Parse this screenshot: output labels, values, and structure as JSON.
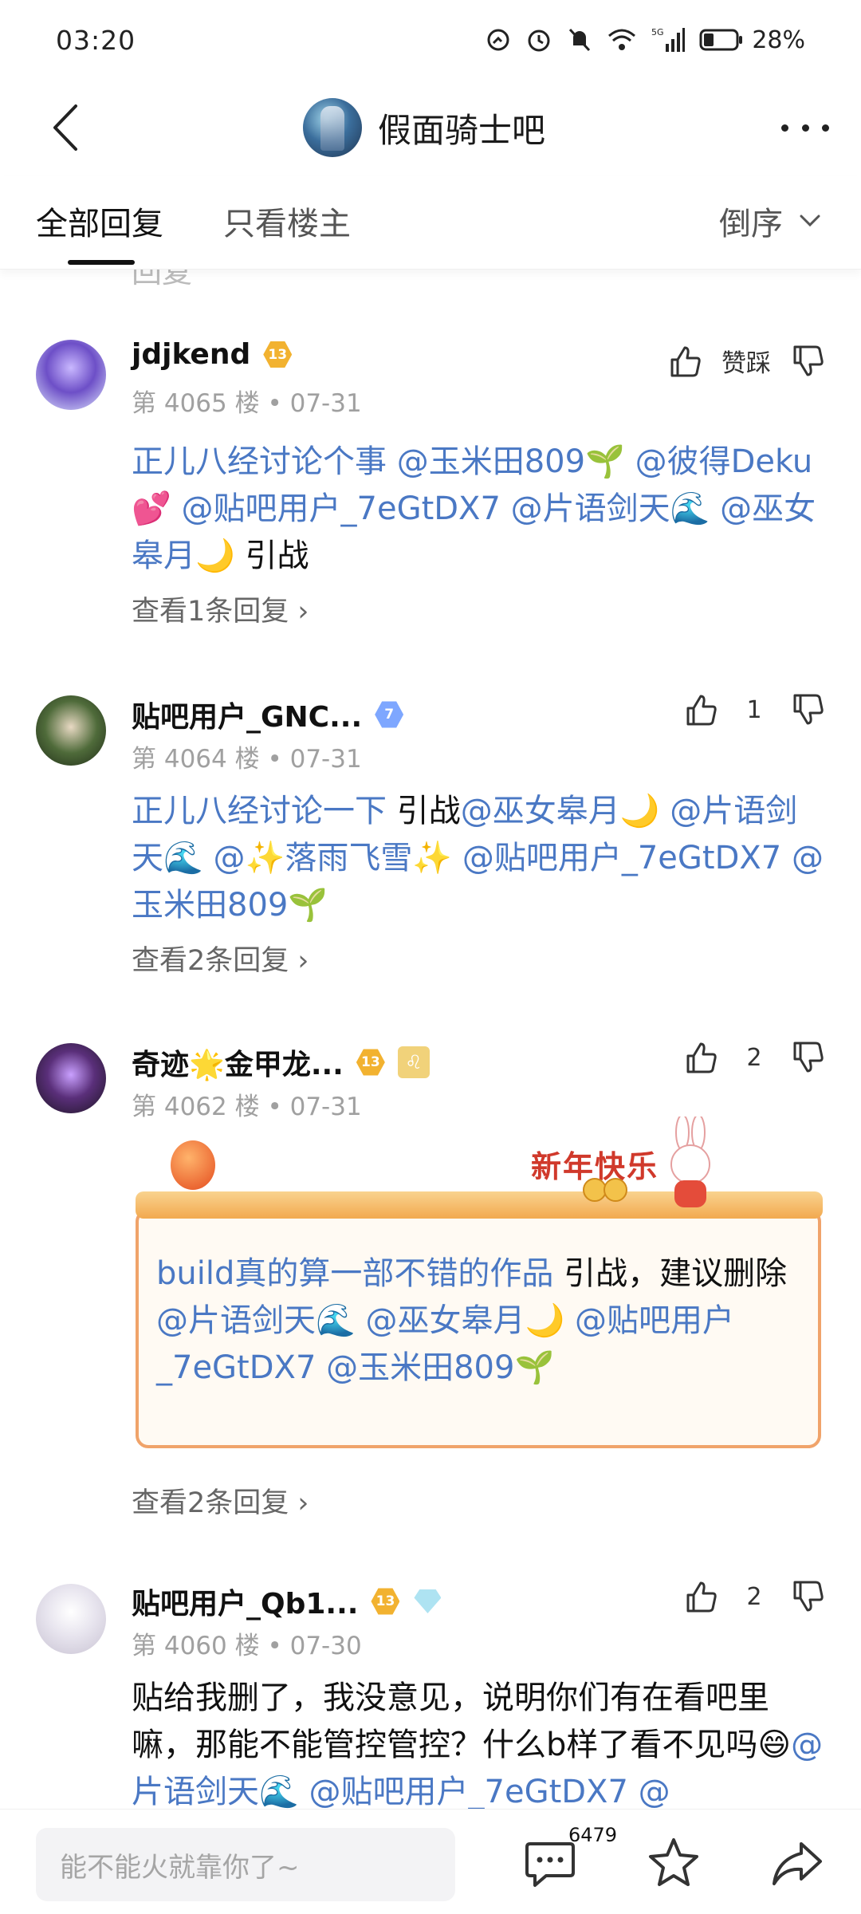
{
  "status_bar": {
    "time": "03:20",
    "network": "5G",
    "battery": "28%"
  },
  "header": {
    "forum_name": "假面骑士吧"
  },
  "tabs": {
    "all_replies": "全部回复",
    "owner_only": "只看楼主",
    "sort": "倒序"
  },
  "feed": {
    "clipped_hint": "回复",
    "posts": [
      {
        "username": "jdjkend",
        "level": "13",
        "floor": "第 4065 楼",
        "date": "07-31",
        "vote_label": "赞踩",
        "body_mention_1": "正儿八经讨论个事 @玉米田809🌱 @彼得Deku💕 @贴吧用户_7eGtDX7 @片语剑天🌊 @巫女皋月🌙",
        "body_text_1": " 引战",
        "replies": "查看1条回复"
      },
      {
        "username": "贴吧用户_GNC...",
        "level": "7",
        "floor": "第 4064 楼",
        "date": "07-31",
        "votes": "1",
        "body_mention_1": "正儿八经讨论一下",
        "body_text_1": " 引战",
        "body_mention_2": "@巫女皋月🌙 @片语剑天🌊 @✨落雨飞雪✨ @贴吧用户_7eGtDX7 @玉米田809🌱",
        "replies": "查看2条回复"
      },
      {
        "username": "奇迹🌟金甲龙...",
        "level": "13",
        "floor": "第 4062 楼",
        "date": "07-31",
        "votes": "2",
        "card_title": "新年快乐",
        "body_mention_1": "build真的算一部不错的作品",
        "body_text_1": " 引战，建议删除",
        "body_mention_2": "@片语剑天🌊 @巫女皋月🌙 @贴吧用户_7eGtDX7 @玉米田809🌱",
        "replies": "查看2条回复"
      },
      {
        "username": "贴吧用户_Qb1...",
        "level": "13",
        "floor": "第 4060 楼",
        "date": "07-30",
        "votes": "2",
        "body_text_1": "贴给我删了，我没意见，说明你们有在看吧里嘛，那能不能管控管控？什么b样了看不见吗😄",
        "body_mention_1": "@片语剑天🌊 @贴吧用户_7eGtDX7 @"
      }
    ]
  },
  "bottom_bar": {
    "input_placeholder": "能不能火就靠你了~",
    "comment_count": "6479"
  }
}
